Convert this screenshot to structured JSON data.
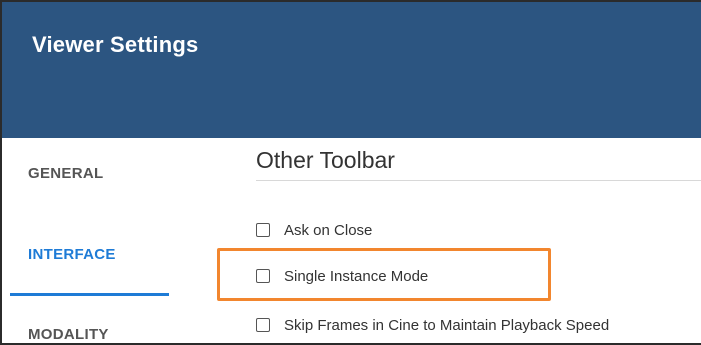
{
  "header": {
    "title": "Viewer Settings"
  },
  "sidebar": {
    "items": [
      {
        "label": "GENERAL"
      },
      {
        "label": "INTERFACE"
      },
      {
        "label": "MODALITY"
      }
    ],
    "active_item": "INTERFACE"
  },
  "main": {
    "section_title": "Other Toolbar",
    "options": [
      {
        "label": "Ask on Close",
        "checked": false
      },
      {
        "label": "Single Instance Mode",
        "checked": false
      },
      {
        "label": "Skip Frames in Cine to Maintain Playback Speed",
        "checked": false
      }
    ]
  },
  "colors": {
    "header_bg": "#2c5581",
    "accent": "#1e7bd6",
    "highlight": "#f2862e"
  }
}
